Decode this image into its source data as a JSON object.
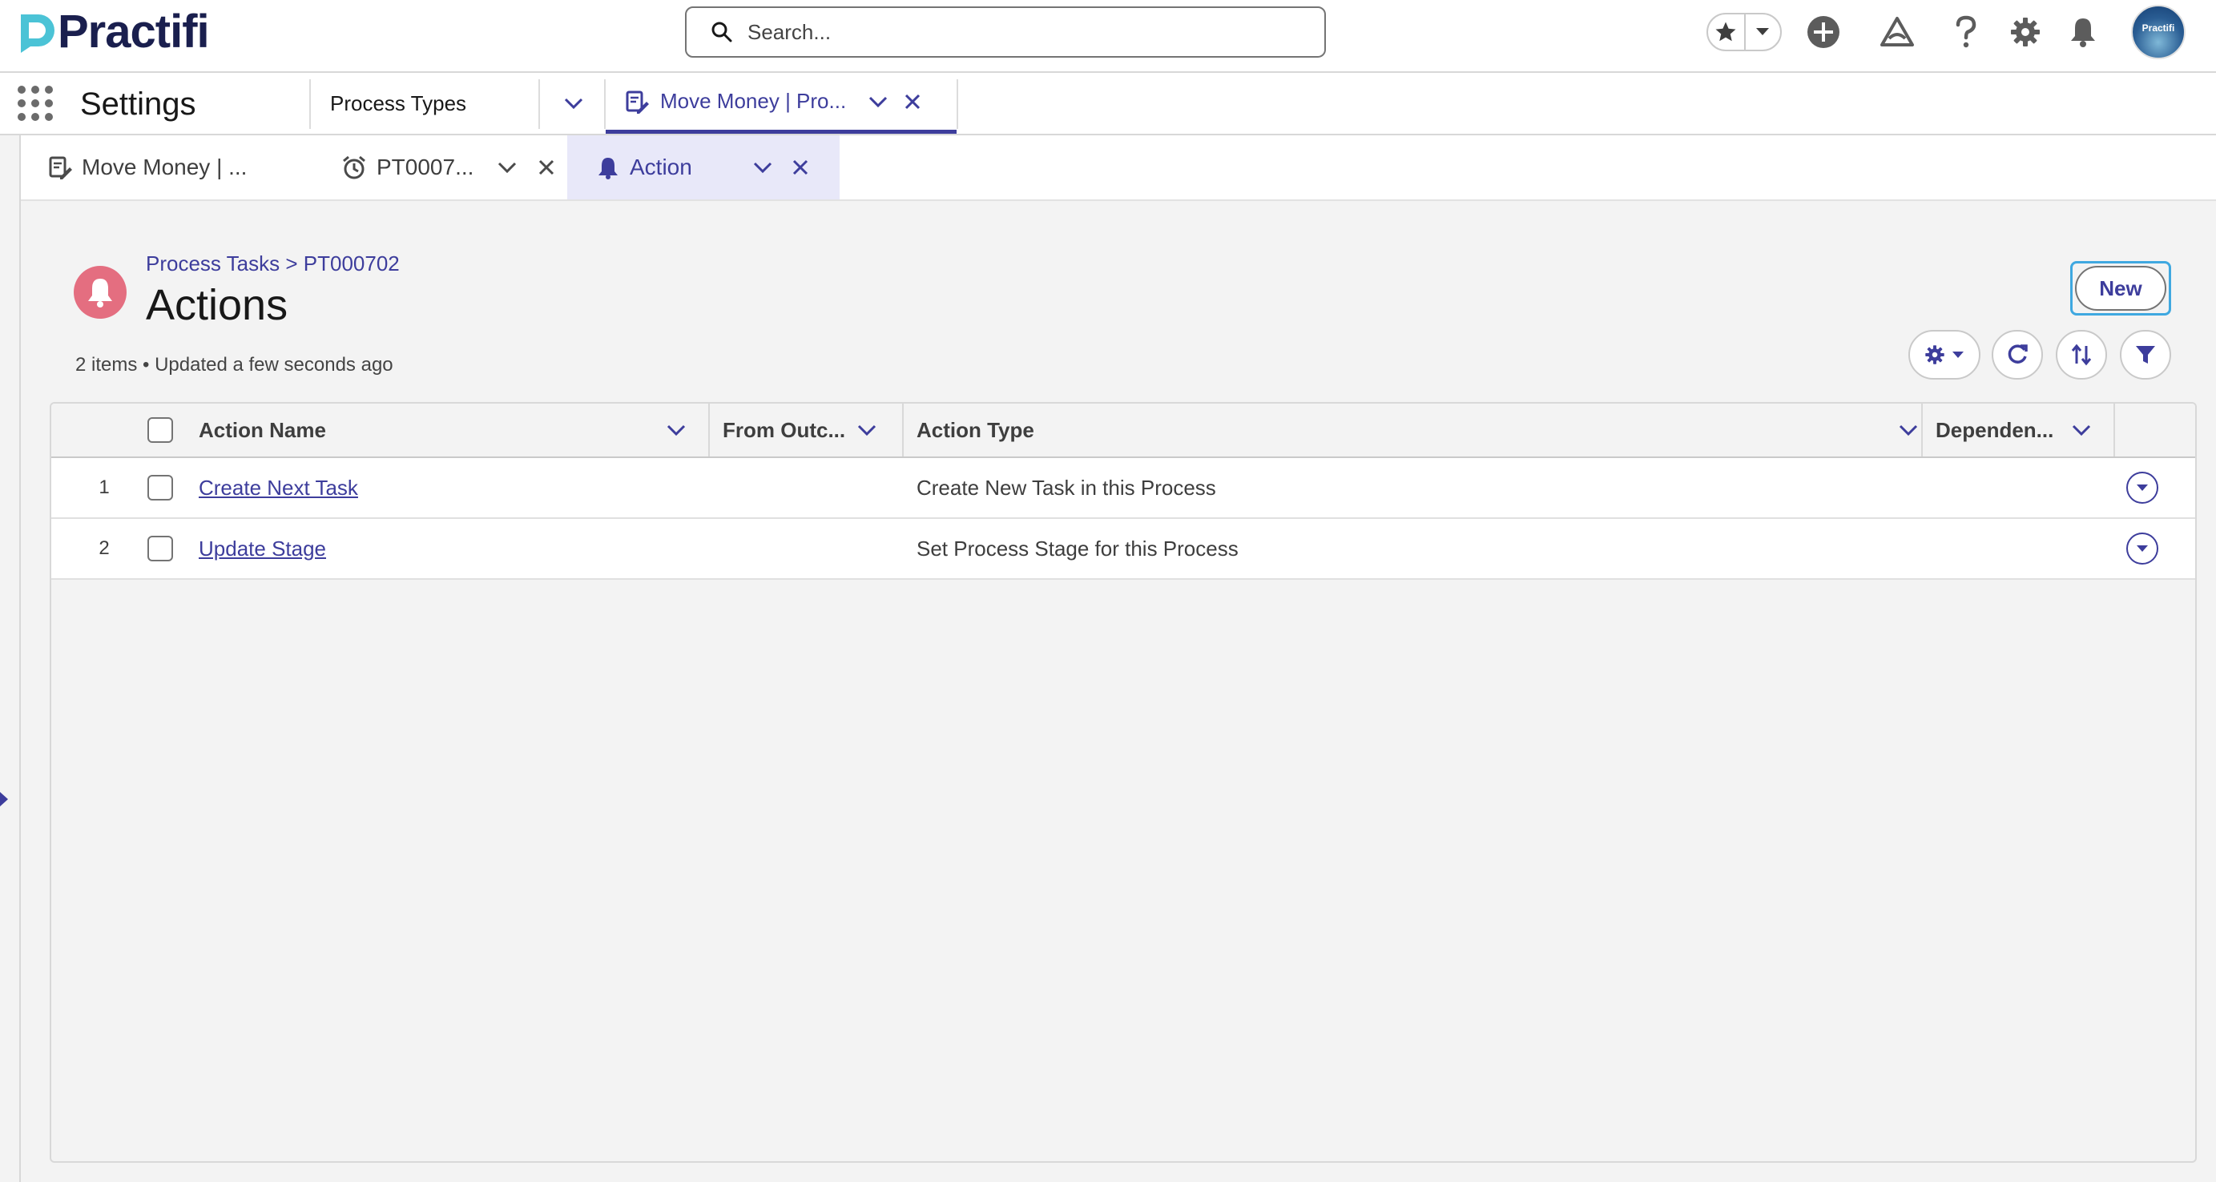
{
  "brand": {
    "name": "Practifi",
    "accent": "#3d3d9c",
    "logo_color": "#4bc3d6"
  },
  "search": {
    "placeholder": "Search..."
  },
  "header_icons": [
    "star-icon",
    "chevron-down-icon",
    "add-icon",
    "trailhead-icon",
    "help-icon",
    "setup-gear-icon",
    "notification-bell-icon"
  ],
  "avatar": {
    "label": "Practifi"
  },
  "nav": {
    "app_name": "Settings",
    "items": [
      {
        "label": "Process Types"
      },
      {
        "label": "Move Money | Pro..."
      }
    ]
  },
  "subtabs": [
    {
      "label": "Move Money | ..."
    },
    {
      "label": "PT0007..."
    },
    {
      "label": "Action"
    }
  ],
  "list": {
    "breadcrumb": "Process Tasks > PT000702",
    "title": "Actions",
    "meta": "2 items • Updated a few seconds ago",
    "new_button": "New",
    "icon_color": "#e46e80"
  },
  "table": {
    "columns": [
      "Action Name",
      "From Outc...",
      "Action Type",
      "Dependen..."
    ],
    "rows": [
      {
        "num": "1",
        "name": "Create Next Task",
        "from_outcome": "",
        "type": "Create New Task in this Process",
        "dependency": ""
      },
      {
        "num": "2",
        "name": "Update Stage",
        "from_outcome": "",
        "type": "Set Process Stage for this Process",
        "dependency": ""
      }
    ]
  }
}
